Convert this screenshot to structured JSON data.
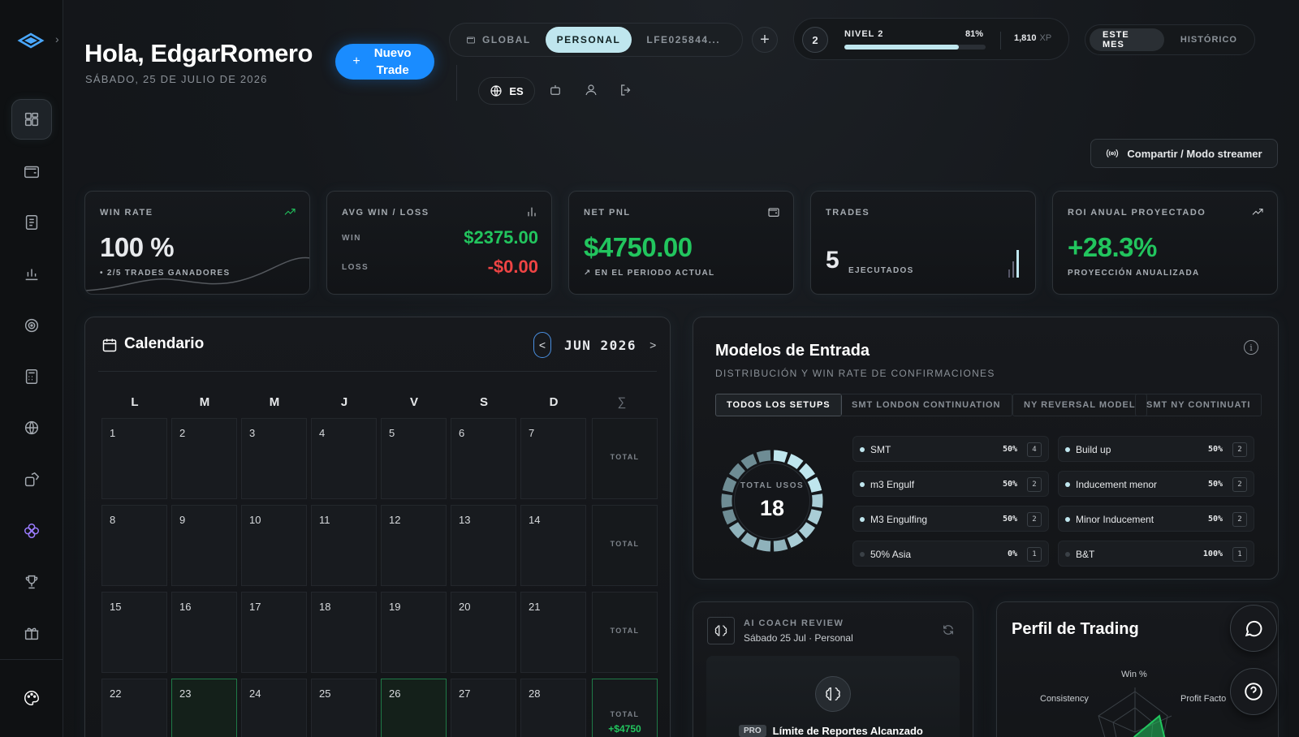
{
  "header": {
    "greeting": "Hola, EdgarRomero",
    "date": "SÁBADO, 25 DE JULIO DE 2026",
    "new_trade_label": "Nuevo Trade",
    "new_trade_icon": "plus-icon"
  },
  "scope_tabs": [
    {
      "label": "GLOBAL",
      "active": false
    },
    {
      "label": "PERSONAL",
      "active": true
    },
    {
      "label": "LFE025844...",
      "active": false
    }
  ],
  "language": "ES",
  "level": {
    "label": "NIVEL 2",
    "number": "2",
    "percent_label": "81%",
    "progress": 0.81,
    "xp": "1,810",
    "xp_unit": "XP"
  },
  "period_tabs": [
    {
      "label": "ESTE MES",
      "active": true
    },
    {
      "label": "HISTÓRICO",
      "active": false
    }
  ],
  "share_button": "Compartir / Modo streamer",
  "kpis": {
    "win_rate": {
      "label": "WIN RATE",
      "value": "100",
      "unit": "%",
      "sub": "2/5 TRADES GANADORES"
    },
    "avg": {
      "label": "AVG WIN / LOSS",
      "win_label": "WIN",
      "win_value": "$2375.00",
      "loss_label": "LOSS",
      "loss_value": "-$0.00"
    },
    "net": {
      "label": "NET PNL",
      "value": "$4750.00",
      "sub": "EN EL PERIODO ACTUAL"
    },
    "trades": {
      "label": "TRADES",
      "value": "5",
      "sub": "EJECUTADOS"
    },
    "roi": {
      "label": "ROI ANUAL PROYECTADO",
      "value": "+28.3%",
      "sub": "PROYECCIÓN ANUALIZADA"
    }
  },
  "calendar": {
    "title": "Calendario",
    "month": "JUN 2026",
    "prev": "<",
    "next": ">",
    "days_of_week": [
      "L",
      "M",
      "M",
      "J",
      "V",
      "S",
      "D"
    ],
    "sum_symbol": "∑",
    "total_label": "TOTAL",
    "weeks": [
      {
        "days": [
          "1",
          "2",
          "3",
          "4",
          "5",
          "6",
          "7"
        ],
        "highlighted": [],
        "total": ""
      },
      {
        "days": [
          "8",
          "9",
          "10",
          "11",
          "12",
          "13",
          "14"
        ],
        "highlighted": [],
        "total": ""
      },
      {
        "days": [
          "15",
          "16",
          "17",
          "18",
          "19",
          "20",
          "21"
        ],
        "highlighted": [],
        "total": ""
      },
      {
        "days": [
          "22",
          "23",
          "24",
          "25",
          "26",
          "27",
          "28"
        ],
        "highlighted": [
          "23",
          "26"
        ],
        "total": "+$4750"
      }
    ]
  },
  "models": {
    "title": "Modelos de Entrada",
    "subtitle": "DISTRIBUCIÓN Y WIN RATE DE CONFIRMACIONES",
    "tabs": [
      "TODOS LOS SETUPS",
      "SMT LONDON CONTINUATION",
      "NY REVERSAL MODEL",
      "SMT NY CONTINUATI"
    ],
    "total_label": "TOTAL USOS",
    "total_value": "18",
    "items": [
      {
        "name": "SMT",
        "pct": "50%",
        "count": "4",
        "active": true
      },
      {
        "name": "Build up",
        "pct": "50%",
        "count": "2",
        "active": true
      },
      {
        "name": "m3 Engulf",
        "pct": "50%",
        "count": "2",
        "active": true
      },
      {
        "name": "Inducement menor",
        "pct": "50%",
        "count": "2",
        "active": true
      },
      {
        "name": "M3 Engulfing",
        "pct": "50%",
        "count": "2",
        "active": true
      },
      {
        "name": "Minor Inducement",
        "pct": "50%",
        "count": "2",
        "active": true
      },
      {
        "name": "50% Asia",
        "pct": "0%",
        "count": "1",
        "active": false
      },
      {
        "name": "B&T",
        "pct": "100%",
        "count": "1",
        "active": false
      }
    ]
  },
  "ai_coach": {
    "label": "AI COACH REVIEW",
    "sub": "Sábado 25 Jul · Personal",
    "pro_badge": "PRO",
    "limit_text": "Límite de Reportes Alcanzado"
  },
  "profile": {
    "title": "Perfil de Trading",
    "axes": [
      "Win %",
      "Consistency",
      "Profit Facto"
    ]
  },
  "colors": {
    "accent": "#1a8cff",
    "green": "#22c55e",
    "red": "#ef4444",
    "cyan": "#bfe6ee"
  }
}
